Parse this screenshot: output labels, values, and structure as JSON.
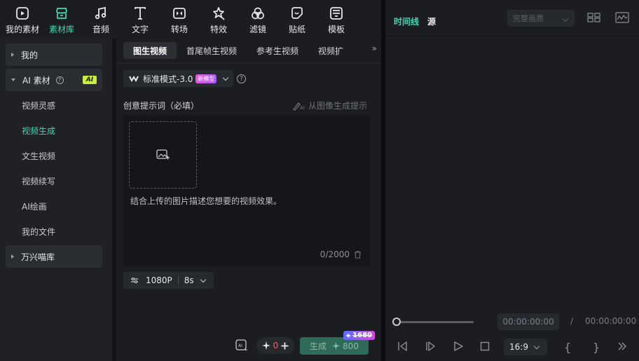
{
  "toolbar": {
    "items": [
      {
        "label": "我的素材",
        "icon": "my-media-icon"
      },
      {
        "label": "素材库",
        "icon": "store-icon",
        "active": true
      },
      {
        "label": "音频",
        "icon": "music-note-icon"
      },
      {
        "label": "文字",
        "icon": "text-icon"
      },
      {
        "label": "转场",
        "icon": "transition-icon"
      },
      {
        "label": "特效",
        "icon": "effects-icon"
      },
      {
        "label": "滤镜",
        "icon": "filter-icon"
      },
      {
        "label": "贴纸",
        "icon": "sticker-icon"
      },
      {
        "label": "模板",
        "icon": "template-icon"
      }
    ],
    "accent_color": "#3fd9b6"
  },
  "sidebar": {
    "group_mine": "我的",
    "group_ai": "AI 素材",
    "ai_badge": "AI",
    "items": [
      {
        "label": "视频灵感"
      },
      {
        "label": "视频生成",
        "active": true
      },
      {
        "label": "文生视频"
      },
      {
        "label": "视频续写"
      },
      {
        "label": "AI绘画"
      },
      {
        "label": "我的文件"
      }
    ],
    "group_library": "万兴喵库"
  },
  "tabs": {
    "items": [
      "图生视频",
      "首尾帧生视频",
      "参考生视频",
      "视频扩"
    ],
    "active_index": 0
  },
  "model": {
    "label": "标准模式-3.0",
    "badge": "新模型"
  },
  "prompt": {
    "label": "创意提示词（必填）",
    "from_image": "从图像生成提示",
    "placeholder": "结合上传的图片描述您想要的视频效果。",
    "counter": "0/2000"
  },
  "settings": {
    "resolution": "1080P",
    "duration": "8s"
  },
  "generate": {
    "credits": "0",
    "label": "生成",
    "cost": "800",
    "old_price": "1680"
  },
  "preview": {
    "tab_timeline": "时间线",
    "tab_source": "源",
    "quality": "完整画质",
    "current_time": "00:00:00:00",
    "separator": "/",
    "total_time": "00:00:00:00",
    "ratio": "16:9",
    "mark_in": "{",
    "mark_out": "}"
  }
}
